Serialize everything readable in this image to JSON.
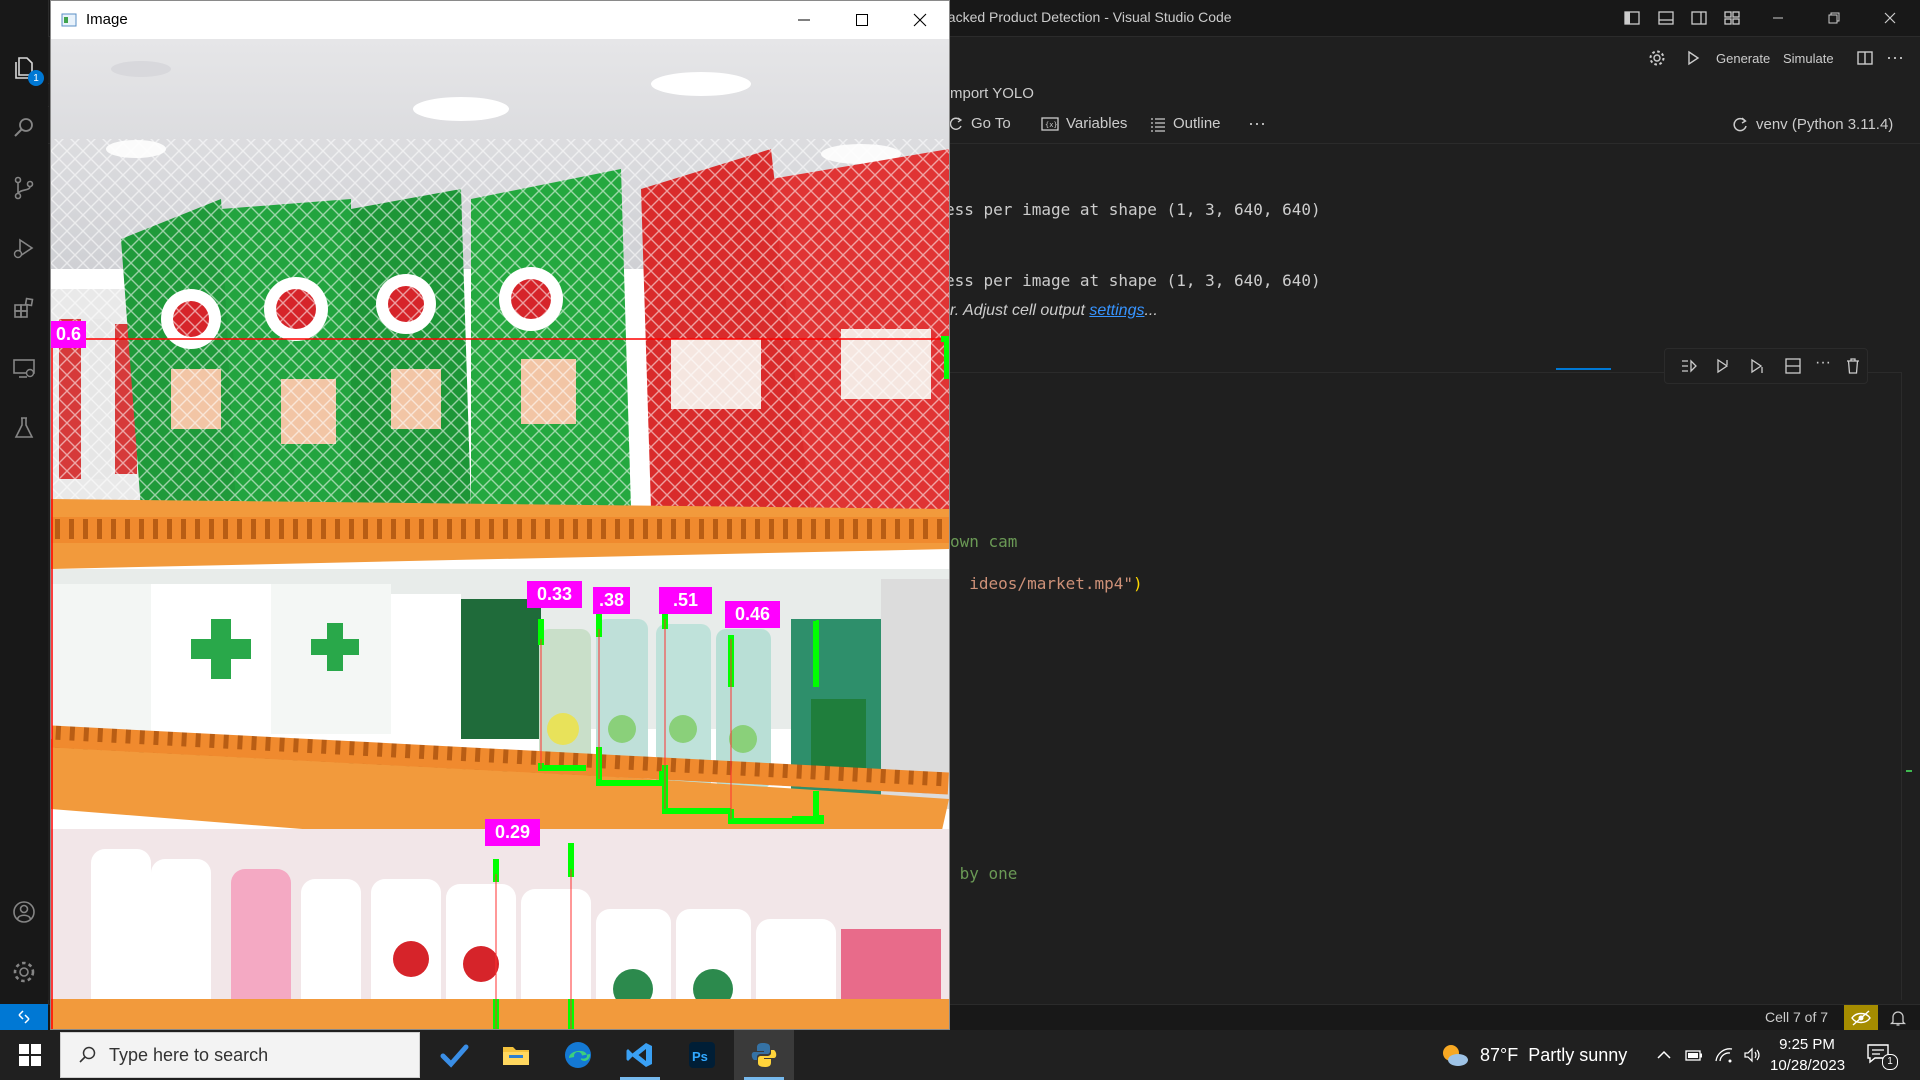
{
  "vscode": {
    "title": "packed Product Detection - Visual Studio Code",
    "explorer_badge": "1",
    "toolbar": {
      "generate_label": "Generate",
      "simulate_label": "Simulate"
    },
    "breadcrumb": "mport YOLO",
    "notebook_toolbar": {
      "goto_label": "Go To",
      "variables_label": "Variables",
      "outline_label": "Outline",
      "kernel_label": "venv (Python 3.11.4)"
    },
    "output_lines": [
      "ess per image at shape (1, 3, 640, 640)",
      "ess per image at shape (1, 3, 640, 640)"
    ],
    "truncated": {
      "prefix": "r. Adjust cell output ",
      "link": "settings",
      "suffix": "..."
    },
    "code": {
      "line1_comment": "own cam",
      "line2_string": "ideos/market.mp4\"",
      "line2_paren": ")",
      "line3_comment": " by one"
    },
    "status": {
      "cell_count": "Cell 7 of 7"
    }
  },
  "image_window": {
    "title": "Image",
    "detections": [
      "0.6",
      "0.33",
      ".38",
      ".51",
      "0.46",
      "0.29"
    ]
  },
  "taskbar": {
    "search_placeholder": "Type here to search",
    "weather_temp": "87°F",
    "weather_desc": "Partly sunny",
    "time": "9:25 PM",
    "date": "10/28/2023",
    "notification_count": "1"
  },
  "colors": {
    "accent": "#0078d4",
    "detection_box": "#00ff00",
    "detection_label": "#ff00ff"
  }
}
